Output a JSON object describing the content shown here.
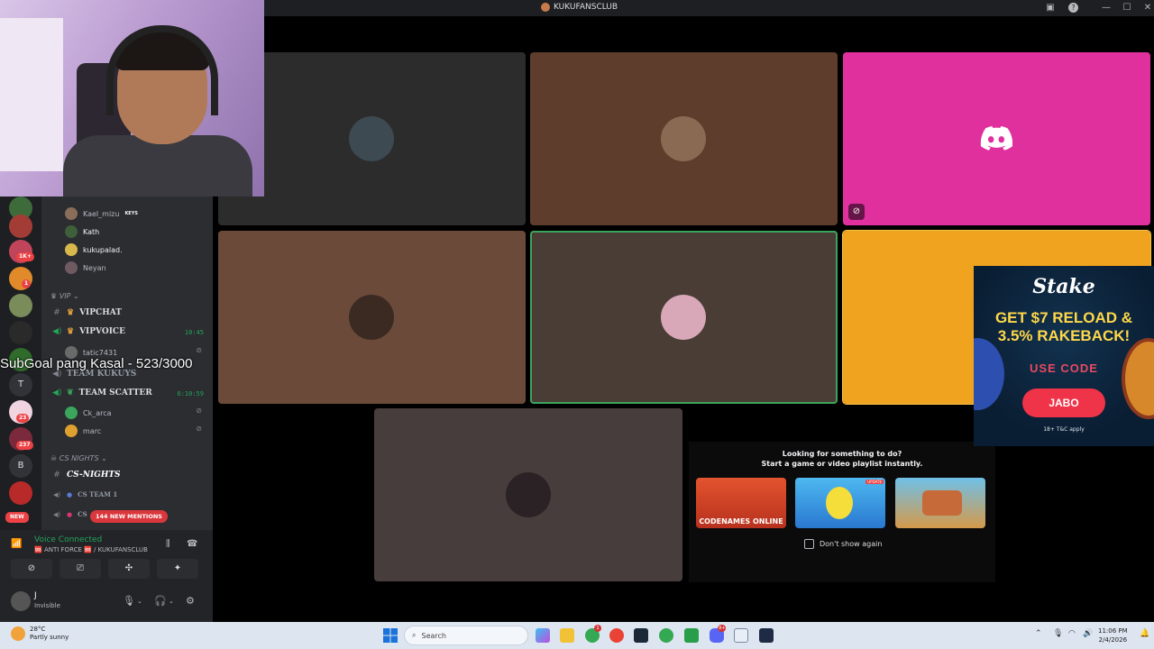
{
  "window": {
    "title": "KUKUFANSCLUB",
    "controls": {
      "help": "?",
      "minimize": "—",
      "maximize": "☐",
      "close": "✕",
      "inbox": "▣"
    }
  },
  "rail": {
    "badges": [
      "1K+",
      "1",
      "23",
      "237"
    ],
    "letters": [
      "T",
      "B"
    ],
    "new_label": "NEW"
  },
  "channels": {
    "voice_users_top": [
      {
        "name": "Kael_mizu",
        "tag": "KEYS"
      },
      {
        "name": "Kath",
        "tag": ""
      },
      {
        "name": "kukupalad.",
        "tag": ""
      },
      {
        "name": "Neyan",
        "tag": ""
      }
    ],
    "vip_category": "VIP",
    "vipchat": "VIPCHAT",
    "vipvoice": "VIPVOICE",
    "vipvoice_time": "10:45",
    "vipvoice_user": "tatic7431",
    "team_kukuys": "TEAM KUKUYS",
    "team_scatter": "TEAM SCATTER",
    "team_scatter_time": "6:10:59",
    "scatter_users": [
      {
        "name": "Ck_arca"
      },
      {
        "name": "marc"
      }
    ],
    "cs_category": "CS NIGHTS",
    "cs_nights": "CS-NIGHTS",
    "cs_team_1": "CS TEAM 1",
    "cs_team_2": "CS",
    "new_mentions": "144 NEW MENTIONS"
  },
  "voice_panel": {
    "status": "Voice Connected",
    "location": "🆘 ANTI FORCE 🆘 / KUKUFANSCLUB"
  },
  "user": {
    "name": "J",
    "status": "Invisible"
  },
  "overlay": {
    "subgoal": "SubGoal pang Kasal - 523/3000"
  },
  "activity": {
    "prompt_line1": "Looking for something to do?",
    "prompt_line2": "Start a game or video playlist instantly.",
    "games": [
      {
        "label": "CODENAMES ONLINE",
        "badge": ""
      },
      {
        "label": "",
        "badge": "UPDATE"
      },
      {
        "label": "",
        "badge": ""
      }
    ],
    "dont_show": "Don't show again"
  },
  "ad": {
    "brand": "Stake",
    "offer_line1": "GET $7 RELOAD &",
    "offer_line2": "3.5% RAKEBACK!",
    "use_code": "USE CODE",
    "code": "JABO",
    "terms": "18+ T&C apply"
  },
  "taskbar": {
    "temp": "28°C",
    "weather": "Partly sunny",
    "search_placeholder": "Search",
    "time": "11:06 PM",
    "date": "2/4/2026",
    "badges": [
      "1",
      "9+"
    ]
  },
  "colors": {
    "discord_blurple": "#5865f2",
    "speaking_green": "#3ba55c",
    "tile_dark": "#2b2c2b",
    "tile_brown": "#5e3d2c",
    "tile_pink": "#e0309e",
    "tile_tan": "#6b4a3a",
    "tile_gray_brown": "#4a3d36",
    "tile_orange": "#f0a31e",
    "tile_mauve": "#463d3c"
  }
}
